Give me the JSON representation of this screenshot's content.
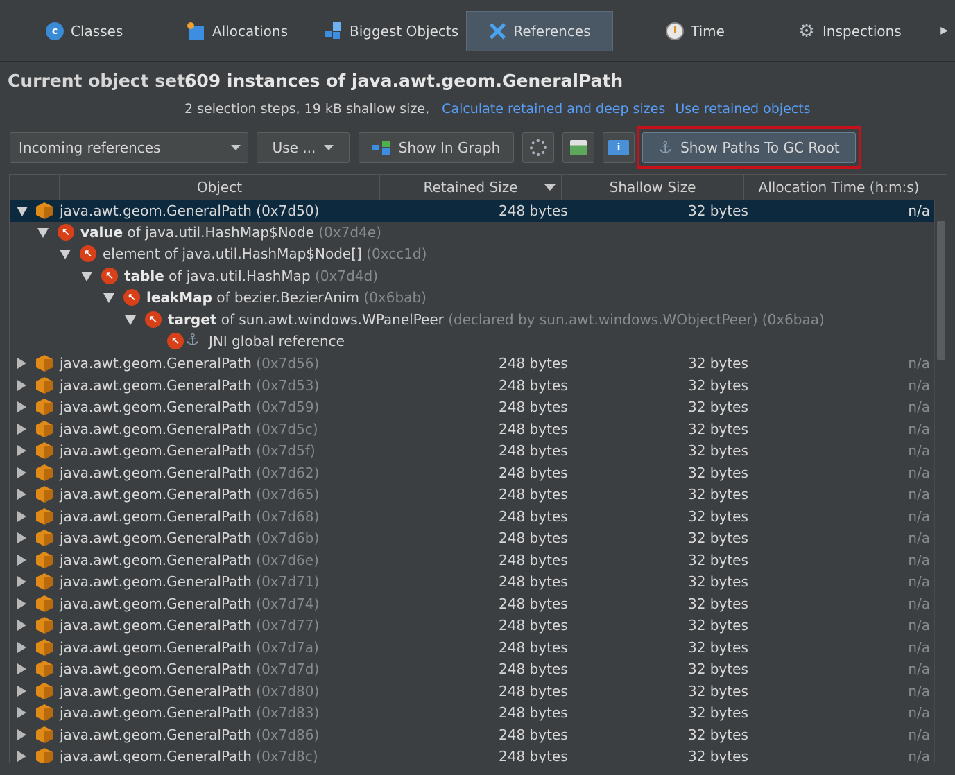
{
  "tabs": [
    {
      "label": "Classes",
      "icon": "classes-icon"
    },
    {
      "label": "Allocations",
      "icon": "allocations-icon"
    },
    {
      "label": "Biggest Objects",
      "icon": "biggest-objects-icon"
    },
    {
      "label": "References",
      "icon": "references-icon",
      "active": true
    },
    {
      "label": "Time",
      "icon": "clock-icon"
    },
    {
      "label": "Inspections",
      "icon": "gear-icon"
    }
  ],
  "header": {
    "label": "Current object set:",
    "value": "609 instances of java.awt.geom.GeneralPath",
    "summary": "2 selection steps, 19 kB shallow size,",
    "link_calc": "Calculate retained and deep sizes",
    "link_use": "Use retained objects"
  },
  "toolbar": {
    "combo_value": "Incoming references",
    "use_label": "Use ...",
    "graph_label": "Show In Graph",
    "gc_label": "Show Paths To GC Root"
  },
  "table": {
    "columns": [
      "Object",
      "Retained Size",
      "Shallow Size",
      "Allocation Time (h:m:s)"
    ],
    "selected": {
      "name": "java.awt.geom.GeneralPath (0x7d50)",
      "retained": "248 bytes",
      "shallow": "32 bytes",
      "alloc": "n/a"
    },
    "tree": [
      {
        "bold": "value",
        "text": " of java.util.HashMap$Node",
        "dim": " (0x7d4e)"
      },
      {
        "bold": "",
        "text": "element of java.util.HashMap$Node[]",
        "dim": " (0xcc1d)"
      },
      {
        "bold": "table",
        "text": " of java.util.HashMap",
        "dim": " (0x7d4d)"
      },
      {
        "bold": "leakMap",
        "text": " of bezier.BezierAnim",
        "dim": " (0x6bab)"
      },
      {
        "bold": "target",
        "text": " of sun.awt.windows.WPanelPeer",
        "dim": " (declared by sun.awt.windows.WObjectPeer) (0x6baa)"
      },
      {
        "bold": "",
        "text": "JNI global reference",
        "dim": ""
      }
    ],
    "row_name": "java.awt.geom.GeneralPath",
    "row_retained": "248 bytes",
    "row_shallow": "32 bytes",
    "row_alloc": "n/a",
    "rows": [
      "(0x7d56)",
      "(0x7d53)",
      "(0x7d59)",
      "(0x7d5c)",
      "(0x7d5f)",
      "(0x7d62)",
      "(0x7d65)",
      "(0x7d68)",
      "(0x7d6b)",
      "(0x7d6e)",
      "(0x7d71)",
      "(0x7d74)",
      "(0x7d77)",
      "(0x7d7a)",
      "(0x7d7d)",
      "(0x7d80)",
      "(0x7d83)",
      "(0x7d86)",
      "(0x7d8c)"
    ]
  }
}
